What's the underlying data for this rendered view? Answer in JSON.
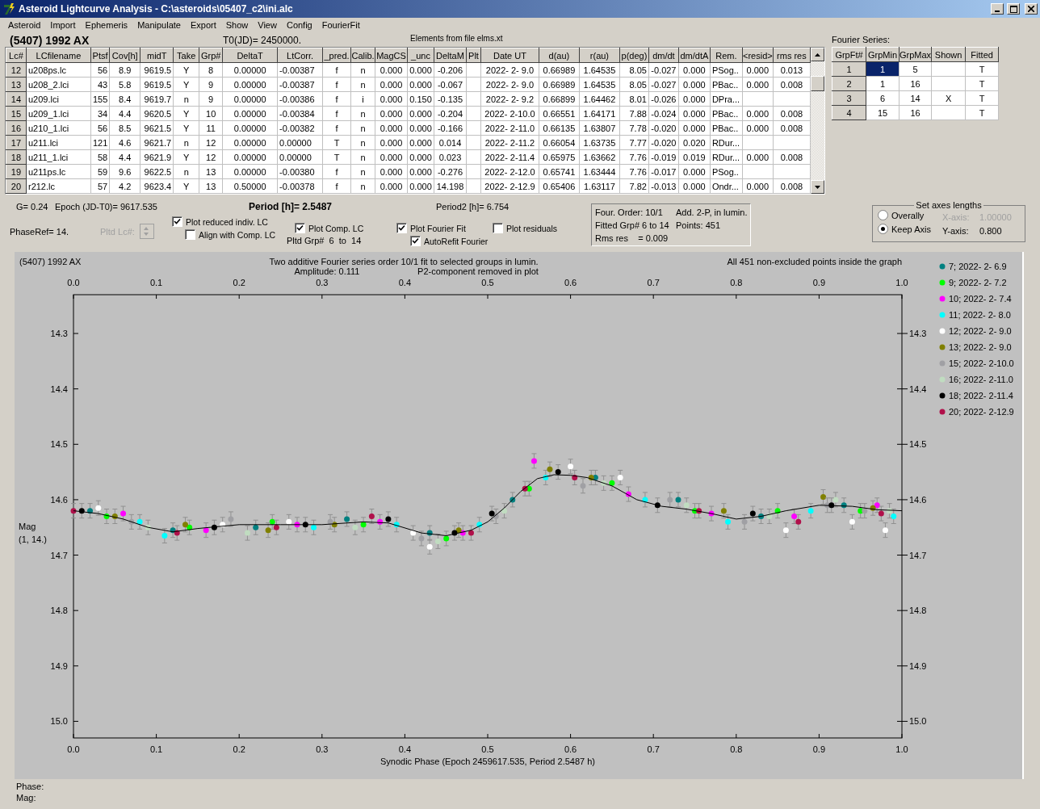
{
  "window": {
    "title": "Asteroid Lightcurve Analysis - C:\\asteroids\\05407_c2\\ini.alc"
  },
  "menu": [
    "Asteroid",
    "Import",
    "Ephemeris",
    "Manipulate",
    "Export",
    "Show",
    "View",
    "Config",
    "FourierFit"
  ],
  "header": {
    "object": "(5407) 1992 AX",
    "t0": "T0(JD)= 2450000.",
    "elements": "Elements from file elms.xt"
  },
  "lc_table": {
    "columns": [
      "Lc#",
      "LCfilename",
      "Ptsf",
      "Cov[h]",
      "midT",
      "Take",
      "Grp#",
      "DeltaT",
      "LtCorr.",
      "_pred.",
      "Calib.",
      "MagCS",
      "_unc",
      "DeltaM",
      "Plt",
      "Date UT",
      "d(au)",
      "r(au)",
      "p(deg)",
      "dm/dt",
      "dm/dtA",
      "Rem.",
      "<resid>",
      "rms res"
    ],
    "rows": [
      {
        "cells": [
          "12",
          "u208ps.lc",
          "56",
          "8.9",
          "9619.5",
          "Y",
          "8",
          "0.00000",
          "-0.00387",
          "f",
          "n",
          "0.000",
          "0.000",
          "-0.206",
          null,
          "2022- 2- 9.0",
          "0.66989",
          "1.64535",
          "8.05",
          "-0.027",
          "0.000",
          "PSog..",
          "0.000",
          "0.013"
        ]
      },
      {
        "cells": [
          "13",
          "u208_2.lci",
          "43",
          "5.8",
          "9619.5",
          "Y",
          "9",
          "0.00000",
          "-0.00387",
          "f",
          "n",
          "0.000",
          "0.000",
          "-0.067",
          null,
          "2022- 2- 9.0",
          "0.66989",
          "1.64535",
          "8.05",
          "-0.027",
          "0.000",
          "PBac..",
          "0.000",
          "0.008"
        ]
      },
      {
        "cells": [
          "14",
          "u209.lci",
          "155",
          "8.4",
          "9619.7",
          "n",
          "9",
          "0.00000",
          "-0.00386",
          "f",
          "i",
          "0.000",
          "0.150",
          "-0.135",
          null,
          "2022- 2- 9.2",
          "0.66899",
          "1.64462",
          "8.01",
          "-0.026",
          "0.000",
          "DPra...",
          null,
          null
        ]
      },
      {
        "cells": [
          "15",
          "u209_1.lci",
          "34",
          "4.4",
          "9620.5",
          "Y",
          "10",
          "0.00000",
          "-0.00384",
          "f",
          "n",
          "0.000",
          "0.000",
          "-0.204",
          null,
          "2022- 2-10.0",
          "0.66551",
          "1.64171",
          "7.88",
          "-0.024",
          "0.000",
          "PBac..",
          "0.000",
          "0.008"
        ]
      },
      {
        "cells": [
          "16",
          "u210_1.lci",
          "56",
          "8.5",
          "9621.5",
          "Y",
          "11",
          "0.00000",
          "-0.00382",
          "f",
          "n",
          "0.000",
          "0.000",
          "-0.166",
          null,
          "2022- 2-11.0",
          "0.66135",
          "1.63807",
          "7.78",
          "-0.020",
          "0.000",
          "PBac..",
          "0.000",
          "0.008"
        ]
      },
      {
        "cells": [
          "17",
          "u211.lci",
          "121",
          "4.6",
          "9621.7",
          "n",
          "12",
          "0.00000",
          "0.00000",
          "T",
          "n",
          "0.000",
          "0.000",
          "0.014",
          null,
          "2022- 2-11.2",
          "0.66054",
          "1.63735",
          "7.77",
          "-0.020",
          "0.020",
          "RDur...",
          null,
          null
        ]
      },
      {
        "cells": [
          "18",
          "u211_1.lci",
          "58",
          "4.4",
          "9621.9",
          "Y",
          "12",
          "0.00000",
          "0.00000",
          "T",
          "n",
          "0.000",
          "0.000",
          "0.023",
          null,
          "2022- 2-11.4",
          "0.65975",
          "1.63662",
          "7.76",
          "-0.019",
          "0.019",
          "RDur...",
          "0.000",
          "0.008"
        ]
      },
      {
        "cells": [
          "19",
          "u211ps.lc",
          "59",
          "9.6",
          "9622.5",
          "n",
          "13",
          "0.00000",
          "-0.00380",
          "f",
          "n",
          "0.000",
          "0.000",
          "-0.276",
          null,
          "2022- 2-12.0",
          "0.65741",
          "1.63444",
          "7.76",
          "-0.017",
          "0.000",
          "PSog..",
          null,
          null
        ]
      },
      {
        "cells": [
          "20",
          "r212.lc",
          "57",
          "4.2",
          "9623.4",
          "Y",
          "13",
          "0.50000",
          "-0.00378",
          "f",
          "n",
          "0.000",
          "0.000",
          "14.198",
          null,
          "2022- 2-12.9",
          "0.65406",
          "1.63117",
          "7.82",
          "-0.013",
          "0.000",
          "Ondr...",
          "0.000",
          "0.008"
        ]
      }
    ]
  },
  "fourier": {
    "title": "Fourier Series:",
    "columns": [
      "GrpFt#",
      "GrpMin",
      "GrpMax",
      "Shown",
      "Fitted"
    ],
    "rows": [
      {
        "cells": [
          {
            "text": "1",
            "selected": false
          },
          {
            "text": "1",
            "selected": true
          },
          {
            "text": "5",
            "selected": false
          },
          {
            "selected": false
          },
          {
            "text": "T",
            "selected": false
          }
        ]
      },
      {
        "cells": [
          {
            "text": "2",
            "selected": false
          },
          {
            "text": "1",
            "selected": false
          },
          {
            "text": "16",
            "selected": false
          },
          {
            "selected": false
          },
          {
            "text": "T",
            "selected": false
          }
        ]
      },
      {
        "cells": [
          {
            "text": "3",
            "selected": false
          },
          {
            "text": "6",
            "selected": false
          },
          {
            "text": "14",
            "selected": false
          },
          {
            "text": "X",
            "selected": false
          },
          {
            "text": "T",
            "selected": false
          }
        ]
      },
      {
        "cells": [
          {
            "text": "4",
            "selected": false
          },
          {
            "text": "15",
            "selected": false
          },
          {
            "text": "16",
            "selected": false
          },
          {
            "selected": false
          },
          {
            "text": "T",
            "selected": false
          }
        ]
      }
    ]
  },
  "params": {
    "g": "G= 0.24",
    "epoch": "Epoch (JD-T0)= 9617.535",
    "period": "Period [h]= 2.5487",
    "period2": "Period2 [h]= 6.754",
    "phase_ref": "PhaseRef= 14.",
    "pltd_lc": {
      "label": "Pltd Lc#:",
      "disabled": true
    },
    "pltd_grp": "Pltd Grp#  6  to  14"
  },
  "options": [
    {
      "label": "Plot reduced indiv. LC",
      "checked": true
    },
    {
      "label": "Align with Comp. LC",
      "checked": false
    },
    {
      "label": "Plot Comp. LC",
      "checked": true
    },
    {
      "label": "Plot Fourier Fit",
      "checked": true
    },
    {
      "label": "AutoRefit Fourier",
      "checked": true
    },
    {
      "label": "Plot residuals",
      "checked": false
    }
  ],
  "fit_info": [
    [
      "Four. Order: 10/1",
      "Add. 2-P, in lumin."
    ],
    [
      "Fitted Grp# 6 to 14",
      "Points: 451"
    ],
    [
      "Rms res    = 0.009"
    ]
  ],
  "axes": {
    "title": "Set axes lengths",
    "options": [
      {
        "label": "Overally",
        "selected": false,
        "axis_label": "X-axis:",
        "value": "1.00000",
        "disabled": true
      },
      {
        "label": "Keep Axis",
        "selected": true,
        "axis_label": "Y-axis:",
        "value": "0.800",
        "disabled": false
      }
    ]
  },
  "plot": {
    "object": "(5407) 1992 AX",
    "title": "Two additive Fourier series order 10/1 fit to selected groups in lumin.",
    "amplitude": "Amplitude: 0.111",
    "note": "P2-component removed in plot",
    "points_note": "All 451 non-excluded points inside the graph",
    "ylabel_note": "(1, 14.)",
    "chart_data": {
      "type": "scatter",
      "legend": "right",
      "xlabel": "Synodic Phase (Epoch 2459617.535, Period 2.5487 h)",
      "ylabel": "Mag",
      "xlim": [
        0,
        1
      ],
      "ylim": [
        15.03,
        14.23
      ],
      "xticks": [
        {
          "value": 0,
          "label": "0.0"
        },
        {
          "value": 0.1,
          "label": "0.1"
        },
        {
          "value": 0.2,
          "label": "0.2"
        },
        {
          "value": 0.3,
          "label": "0.3"
        },
        {
          "value": 0.4,
          "label": "0.4"
        },
        {
          "value": 0.5,
          "label": "0.5"
        },
        {
          "value": 0.6,
          "label": "0.6"
        },
        {
          "value": 0.7,
          "label": "0.7"
        },
        {
          "value": 0.8,
          "label": "0.8"
        },
        {
          "value": 0.9,
          "label": "0.9"
        },
        {
          "value": 1,
          "label": "1.0"
        }
      ],
      "yticks": [
        {
          "value": 14.3,
          "label": "14.3"
        },
        {
          "value": 14.4,
          "label": "14.4"
        },
        {
          "value": 14.5,
          "label": "14.5"
        },
        {
          "value": 14.6,
          "label": "14.6"
        },
        {
          "value": 14.7,
          "label": "14.7"
        },
        {
          "value": 14.8,
          "label": "14.8"
        },
        {
          "value": 14.9,
          "label": "14.9"
        },
        {
          "value": 15,
          "label": "15.0"
        }
      ],
      "series": [
        {
          "name": "7; 2022- 2- 6.9",
          "color": "#008080",
          "x": [
            0.02,
            0.12,
            0.22,
            0.33,
            0.43,
            0.53,
            0.63,
            0.73,
            0.83,
            0.93
          ],
          "values": [
            14.62,
            14.655,
            14.65,
            14.635,
            14.66,
            14.6,
            14.56,
            14.6,
            14.63,
            14.61
          ]
        },
        {
          "name": "9; 2022- 2- 7.2",
          "color": "#00ff00",
          "x": [
            0.04,
            0.14,
            0.24,
            0.35,
            0.45,
            0.55,
            0.65,
            0.75,
            0.85,
            0.95
          ],
          "values": [
            14.63,
            14.65,
            14.64,
            14.645,
            14.67,
            14.58,
            14.57,
            14.62,
            14.62,
            14.62
          ]
        },
        {
          "name": "10; 2022- 2- 7.4",
          "color": "#ff00ff",
          "x": [
            0.06,
            0.16,
            0.27,
            0.37,
            0.47,
            0.556,
            0.67,
            0.77,
            0.87,
            0.97
          ],
          "values": [
            14.625,
            14.655,
            14.645,
            14.64,
            14.66,
            14.53,
            14.59,
            14.625,
            14.63,
            14.61
          ]
        },
        {
          "name": "11; 2022- 2- 8.0",
          "color": "#00ffff",
          "x": [
            0.08,
            0.11,
            0.29,
            0.39,
            0.49,
            0.57,
            0.69,
            0.79,
            0.89,
            0.99
          ],
          "values": [
            14.64,
            14.665,
            14.65,
            14.645,
            14.645,
            14.56,
            14.6,
            14.64,
            14.62,
            14.63
          ]
        },
        {
          "name": "12; 2022- 2- 9.0",
          "color": "#ffffff",
          "x": [
            0.03,
            0.18,
            0.26,
            0.41,
            0.43,
            0.6,
            0.66,
            0.86,
            0.94,
            0.98
          ],
          "values": [
            14.615,
            14.645,
            14.64,
            14.66,
            14.685,
            14.54,
            14.56,
            14.655,
            14.64,
            14.655
          ]
        },
        {
          "name": "13; 2022- 2- 9.0",
          "color": "#808000",
          "x": [
            0.05,
            0.135,
            0.235,
            0.315,
            0.465,
            0.575,
            0.625,
            0.785,
            0.905,
            0.965
          ],
          "values": [
            14.63,
            14.645,
            14.655,
            14.645,
            14.655,
            14.545,
            14.56,
            14.62,
            14.595,
            14.615
          ]
        },
        {
          "name": "15; 2022- 2-10.0",
          "color": "#a0a0a4",
          "x": [
            0.07,
            0.19,
            0.31,
            0.42,
            0.51,
            0.615,
            0.72,
            0.81,
            0.91,
            0.955
          ],
          "values": [
            14.64,
            14.635,
            14.64,
            14.67,
            14.63,
            14.575,
            14.6,
            14.64,
            14.61,
            14.62
          ]
        },
        {
          "name": "16; 2022- 2-11.0",
          "color": "#c0dcc0",
          "x": [
            0.09,
            0.21,
            0.34,
            0.44,
            0.52,
            0.64,
            0.74,
            0.84,
            0.92,
            0.985
          ],
          "values": [
            14.65,
            14.66,
            14.65,
            14.675,
            14.62,
            14.57,
            14.61,
            14.63,
            14.6,
            14.62
          ]
        },
        {
          "name": "18; 2022- 2-11.4",
          "color": "#000000",
          "x": [
            0.01,
            0.17,
            0.28,
            0.38,
            0.46,
            0.505,
            0.585,
            0.705,
            0.82,
            0.915
          ],
          "values": [
            14.62,
            14.65,
            14.645,
            14.635,
            14.66,
            14.625,
            14.55,
            14.61,
            14.625,
            14.61
          ]
        },
        {
          "name": "20; 2022- 2-12.9",
          "color": "#b0104a",
          "x": [
            0.0,
            0.125,
            0.245,
            0.36,
            0.48,
            0.545,
            0.605,
            0.755,
            0.875,
            0.975
          ],
          "values": [
            14.62,
            14.66,
            14.65,
            14.63,
            14.66,
            14.58,
            14.56,
            14.62,
            14.64,
            14.625
          ]
        },
        {
          "type": "line",
          "color": "#000000",
          "x": [
            0,
            0.03,
            0.06,
            0.09,
            0.12,
            0.15,
            0.2,
            0.25,
            0.3,
            0.35,
            0.38,
            0.42,
            0.45,
            0.48,
            0.5,
            0.52,
            0.54,
            0.56,
            0.58,
            0.6,
            0.62,
            0.65,
            0.68,
            0.71,
            0.74,
            0.77,
            0.8,
            0.83,
            0.86,
            0.9,
            0.94,
            0.97,
            1.0
          ],
          "values": [
            14.62,
            14.625,
            14.635,
            14.65,
            14.658,
            14.652,
            14.645,
            14.645,
            14.645,
            14.64,
            14.642,
            14.66,
            14.665,
            14.655,
            14.64,
            14.615,
            14.585,
            14.562,
            14.555,
            14.556,
            14.56,
            14.575,
            14.6,
            14.612,
            14.617,
            14.625,
            14.635,
            14.63,
            14.62,
            14.61,
            14.612,
            14.618,
            14.62
          ]
        }
      ]
    }
  },
  "status": {
    "phase": "Phase:",
    "mag": "Mag:"
  }
}
